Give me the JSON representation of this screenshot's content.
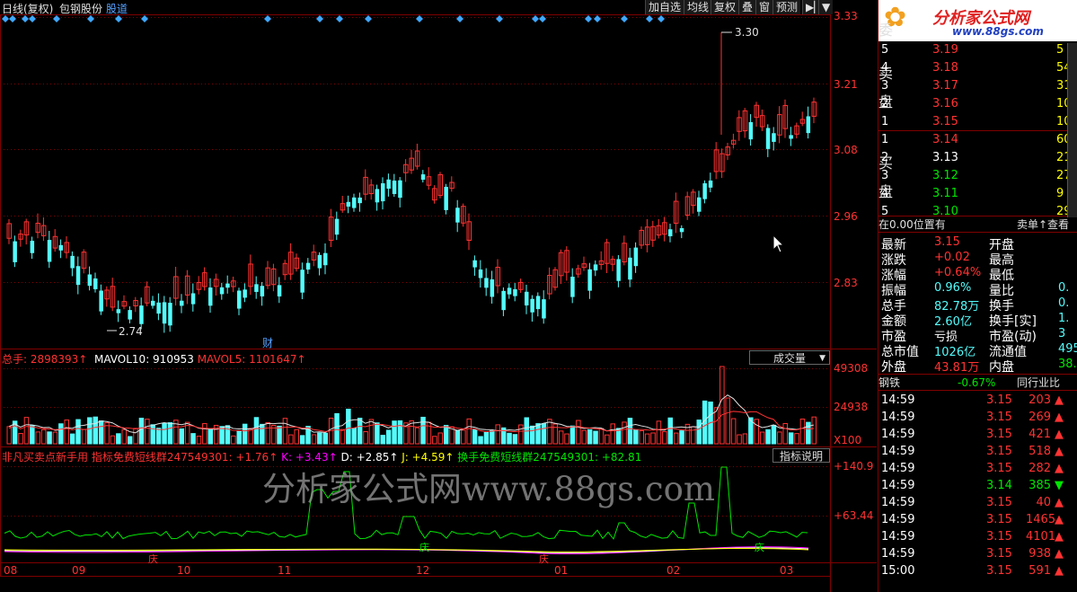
{
  "header": {
    "period": "日线(复权)",
    "stock_name": "包钢股份",
    "link": "股道",
    "buttons": [
      "加自选",
      "均线",
      "复权",
      "叠",
      "窗",
      "预测",
      "▶▏",
      "▼"
    ]
  },
  "price_axis": [
    "3.33",
    "3.21",
    "3.08",
    "2.96",
    "2.83"
  ],
  "annotations": {
    "high": "3.30",
    "low": "2.74",
    "cai": "财"
  },
  "volume_panel": {
    "total_label": "总手: 2898393↑",
    "mavol10": "MAVOL10: 910953",
    "mavol5": "MAVOL5: 1101647↑",
    "dropdown": "成交量",
    "axis": [
      "49308",
      "24938"
    ],
    "unit": "X100"
  },
  "indicator_panel": {
    "title": "非凡买卖点新手用",
    "name": "指标免费短线群247549301: +1.76↑",
    "k": "K: +3.43↑",
    "d": "D: +2.85↑",
    "j": "J: +4.59↑",
    "extra": "换手免费短线群247549301: +82.81",
    "button": "指标说明",
    "axis": [
      "+140.9",
      "+63.44"
    ],
    "watermark": "分析家公式网www.88gs.com",
    "marks": [
      "庆",
      "庆",
      "庆",
      "庆"
    ]
  },
  "x_axis": [
    "08",
    "09",
    "10",
    "11",
    "12",
    "01",
    "02",
    "03"
  ],
  "logo": {
    "text": "分析家公式网",
    "url": "www.88gs.com"
  },
  "orderbook": {
    "wei_label": "委",
    "sell_label": [
      "卖",
      "盘"
    ],
    "buy_label": [
      "买",
      "盘"
    ],
    "sell": [
      {
        "n": "5",
        "p": "3.19",
        "v": "5"
      },
      {
        "n": "4",
        "p": "3.18",
        "v": "54"
      },
      {
        "n": "3",
        "p": "3.17",
        "v": "31"
      },
      {
        "n": "2",
        "p": "3.16",
        "v": "100"
      },
      {
        "n": "1",
        "p": "3.15",
        "v": "10"
      }
    ],
    "buy": [
      {
        "n": "1",
        "p": "3.14",
        "v": "60"
      },
      {
        "n": "2",
        "p": "3.13",
        "v": "21"
      },
      {
        "n": "3",
        "p": "3.12",
        "v": "27"
      },
      {
        "n": "4",
        "p": "3.11",
        "v": "9"
      },
      {
        "n": "5",
        "p": "3.10",
        "v": "29"
      }
    ]
  },
  "position_bar": {
    "left": "在0.00位置有",
    "right": "卖单↑查看"
  },
  "stats": [
    {
      "l": "最新",
      "v": "3.15",
      "r": "开盘",
      "rv": ""
    },
    {
      "l": "涨跌",
      "v": "+0.02",
      "r": "最高",
      "rv": ""
    },
    {
      "l": "涨幅",
      "v": "+0.64%",
      "r": "最低",
      "rv": ""
    },
    {
      "l": "振幅",
      "v": "0.96%",
      "r": "量比",
      "rv": "0."
    },
    {
      "l": "总手",
      "v": "82.78万",
      "r": "换手",
      "rv": "0."
    },
    {
      "l": "金额",
      "v": "2.60亿",
      "r": "换手[实]",
      "rv": "1."
    },
    {
      "l": "市盈",
      "v": "亏损",
      "r": "市盈(动)",
      "rv": "3"
    },
    {
      "l": "总市值",
      "v": "1026亿",
      "r": "流通值",
      "rv": "495"
    },
    {
      "l": "外盘",
      "v": "43.81万",
      "r": "内盘",
      "rv": "38.9"
    }
  ],
  "industry": {
    "name": "钢铁",
    "change": "-0.67%",
    "link": "同行业比"
  },
  "ticks": [
    {
      "t": "14:59",
      "p": "3.15",
      "v": "203",
      "d": "up"
    },
    {
      "t": "14:59",
      "p": "3.15",
      "v": "269",
      "d": "up"
    },
    {
      "t": "14:59",
      "p": "3.15",
      "v": "421",
      "d": "up"
    },
    {
      "t": "14:59",
      "p": "3.15",
      "v": "518",
      "d": "up"
    },
    {
      "t": "14:59",
      "p": "3.15",
      "v": "282",
      "d": "up"
    },
    {
      "t": "14:59",
      "p": "3.14",
      "v": "385",
      "d": "down"
    },
    {
      "t": "14:59",
      "p": "3.15",
      "v": "40",
      "d": "up"
    },
    {
      "t": "14:59",
      "p": "3.15",
      "v": "1465",
      "d": "up"
    },
    {
      "t": "14:59",
      "p": "3.15",
      "v": "4101",
      "d": "up"
    },
    {
      "t": "14:59",
      "p": "3.15",
      "v": "938",
      "d": "up"
    },
    {
      "t": "15:00",
      "p": "3.15",
      "v": "591",
      "d": "up"
    }
  ],
  "colors": {
    "up": "#ff3232",
    "down": "#54fcfc",
    "bg": "#000000",
    "grid": "#800000"
  }
}
